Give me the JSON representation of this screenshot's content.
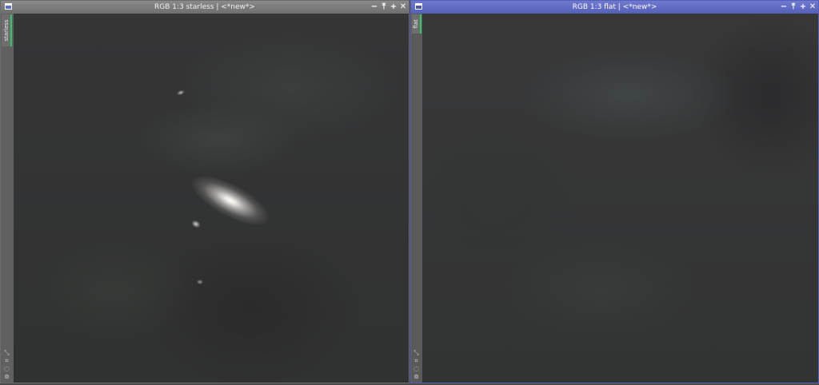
{
  "windows": [
    {
      "title": "RGB 1:3 starless | <*new*>",
      "tab_label": "starless",
      "active": false,
      "controls": [
        "minimize-icon",
        "shade-icon",
        "maximize-icon",
        "close-icon"
      ]
    },
    {
      "title": "RGB 1:3 flat | <*new*>",
      "tab_label": "flat",
      "active": true,
      "controls": [
        "minimize-icon",
        "shade-icon",
        "maximize-icon",
        "close-icon"
      ]
    }
  ],
  "control_glyphs": {
    "minimize": "−",
    "shade": "⤒",
    "maximize": "+",
    "close": "✕"
  },
  "colors": {
    "active_titlebar": "#5560b8",
    "inactive_titlebar": "#7a7a7a",
    "tab_accent": "#2ec86a"
  }
}
